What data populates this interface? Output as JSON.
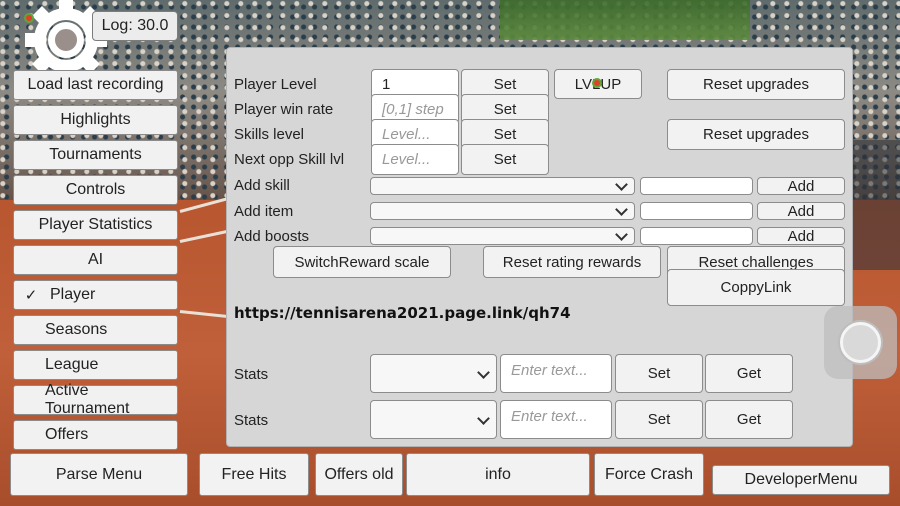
{
  "log": {
    "label": "Log: 30.0"
  },
  "left_menu": [
    {
      "label": "Load last recording"
    },
    {
      "label": "Highlights"
    },
    {
      "label": "Tournaments"
    },
    {
      "label": "Controls"
    },
    {
      "label": "Player Statistics"
    },
    {
      "label": "AI"
    },
    {
      "label": "Player",
      "selected": true,
      "check": "✓"
    },
    {
      "label": "Seasons"
    },
    {
      "label": "League"
    },
    {
      "label": "Active Tournament"
    },
    {
      "label": "Offers"
    }
  ],
  "panel": {
    "rows": {
      "player_level": {
        "label": "Player Level",
        "value": "1",
        "set": "Set"
      },
      "player_win_rate": {
        "label": "Player win rate",
        "placeholder": "[0,1] step",
        "set": "Set"
      },
      "skills_level": {
        "label": "Skills level",
        "placeholder": "Level...",
        "set": "Set"
      },
      "next_opp": {
        "label": "Next opp Skill lvl",
        "placeholder": "Level...",
        "set": "Set"
      }
    },
    "lvlup": "LVLUP",
    "reset_upgrades_1": "Reset upgrades",
    "reset_upgrades_2": "Reset upgrades",
    "add_skill": {
      "label": "Add skill",
      "add": "Add"
    },
    "add_item": {
      "label": "Add item",
      "add": "Add"
    },
    "add_boosts": {
      "label": "Add boosts",
      "add": "Add"
    },
    "switch_reward": "SwitchReward scale",
    "reset_rating": "Reset rating rewards",
    "reset_challenges": "Reset challenges",
    "copy_link": "CoppyLink",
    "link": "https://tennisarena2021.page.link/qh74",
    "stats_rows": [
      {
        "label": "Stats",
        "placeholder": "Enter text...",
        "set": "Set",
        "get": "Get"
      },
      {
        "label": "Stats",
        "placeholder": "Enter text...",
        "set": "Set",
        "get": "Get"
      }
    ]
  },
  "bottom_bar": {
    "parse_menu": "Parse Menu",
    "free_hits": "Free Hits",
    "offers_old": "Offers old",
    "info": "info",
    "force_crash": "Force Crash",
    "developer_menu": "DeveloperMenu"
  },
  "icons": [
    "gear-icon",
    "chevron-down-icon",
    "joystick-icon"
  ]
}
